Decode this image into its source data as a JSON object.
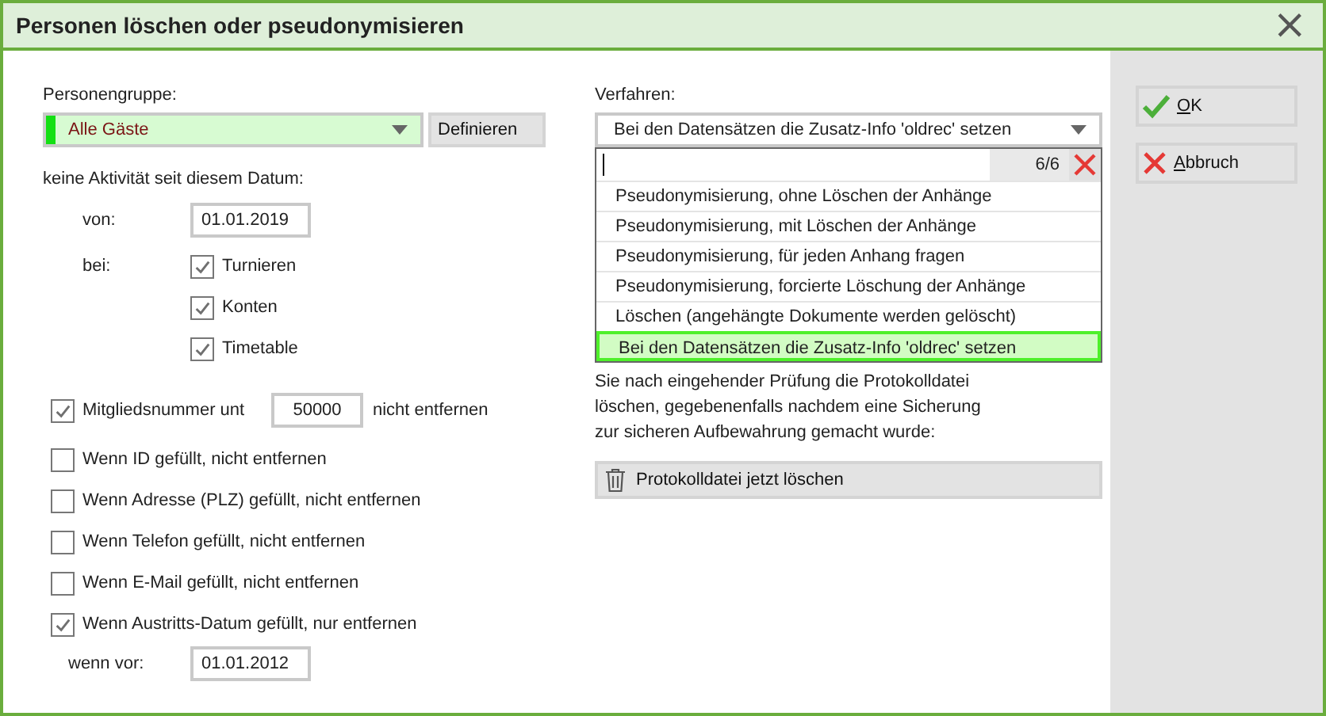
{
  "window": {
    "title": "Personen löschen oder pseudonymisieren",
    "close": "×"
  },
  "group": {
    "label": "Personengruppe:",
    "value": "Alle Gäste",
    "button": "Definieren"
  },
  "activity": {
    "label": "keine Aktivität seit diesem Datum:",
    "from_label": "von:",
    "from_value": "01.01.2019",
    "at_label": "bei:",
    "options": [
      {
        "label": "Turnieren",
        "checked": true
      },
      {
        "label": "Konten",
        "checked": true
      },
      {
        "label": "Timetable",
        "checked": true
      }
    ]
  },
  "member": {
    "label": "Mitgliedsnummer unt",
    "checked": true,
    "value": "50000",
    "suffix": "nicht entfernen"
  },
  "conditions": [
    {
      "label": "Wenn ID gefüllt, nicht entfernen",
      "checked": false
    },
    {
      "label": "Wenn Adresse (PLZ) gefüllt, nicht entfernen",
      "checked": false
    },
    {
      "label": "Wenn Telefon gefüllt, nicht entfernen",
      "checked": false
    },
    {
      "label": "Wenn E-Mail gefüllt, nicht entfernen",
      "checked": false
    },
    {
      "label": "Wenn Austritts-Datum gefüllt, nur entfernen",
      "checked": true
    }
  ],
  "before": {
    "label": "wenn vor:",
    "value": "01.01.2012"
  },
  "procedure": {
    "label": "Verfahren:",
    "value": "Bei den Datensätzen die Zusatz-Info 'oldrec' setzen",
    "count": "6/6",
    "options": [
      {
        "label": "Pseudonymisierung, ohne Löschen der Anhänge",
        "selected": false
      },
      {
        "label": "Pseudonymisierung, mit Löschen der Anhänge",
        "selected": false
      },
      {
        "label": "Pseudonymisierung, für jeden Anhang fragen",
        "selected": false
      },
      {
        "label": "Pseudonymisierung, forcierte Löschung der Anhänge",
        "selected": false
      },
      {
        "label": "Löschen (angehängte Dokumente werden gelöscht)",
        "selected": false
      },
      {
        "label": "Bei den Datensätzen die Zusatz-Info 'oldrec' setzen",
        "selected": true
      }
    ]
  },
  "info": "Sie nach eingehender Prüfung die Protokolldatei löschen, gegebenenfalls nachdem eine Sicherung zur sicheren Aufbewahrung gemacht wurde:",
  "delete_log": "Protokolldatei jetzt löschen",
  "buttons": [
    {
      "kind": "ok",
      "label": "OK"
    },
    {
      "kind": "cancel",
      "label": "Abbruch"
    }
  ]
}
